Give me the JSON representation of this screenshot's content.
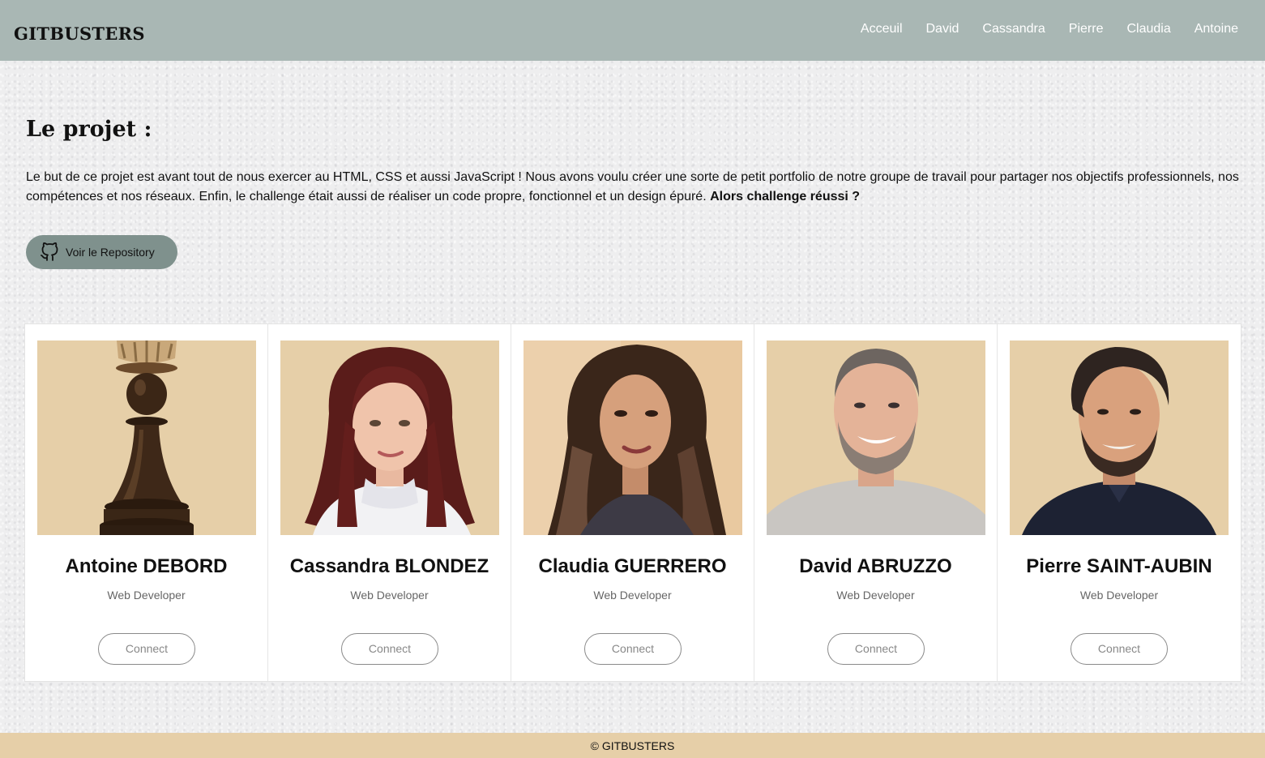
{
  "header": {
    "logo": "GITBUSTERS",
    "nav": [
      "Acceuil",
      "David",
      "Cassandra",
      "Pierre",
      "Claudia",
      "Antoine"
    ]
  },
  "project": {
    "title": "Le projet :",
    "description": "Le but de ce projet est avant tout de nous exercer au HTML, CSS et aussi JavaScript ! Nous avons voulu créer une sorte de petit portfolio de notre groupe de travail pour partager nos objectifs professionnels, nos compétences et nos réseaux. Enfin, le challenge était aussi de réaliser un code propre, fonctionnel et un design épuré.",
    "highlight": "Alors challenge réussi ?",
    "repo_button": "Voir le Repository",
    "repo_icon": "github-icon"
  },
  "team": [
    {
      "name": "Antoine DEBORD",
      "role": "Web Developer",
      "connect": "Connect",
      "photo": "chess-pawn-photo"
    },
    {
      "name": "Cassandra BLONDEZ",
      "role": "Web Developer",
      "connect": "Connect",
      "photo": "portrait-photo"
    },
    {
      "name": "Claudia GUERRERO",
      "role": "Web Developer",
      "connect": "Connect",
      "photo": "portrait-photo"
    },
    {
      "name": "David ABRUZZO",
      "role": "Web Developer",
      "connect": "Connect",
      "photo": "portrait-photo"
    },
    {
      "name": "Pierre SAINT-AUBIN",
      "role": "Web Developer",
      "connect": "Connect",
      "photo": "portrait-photo"
    }
  ],
  "footer": {
    "text": "© GITBUSTERS"
  },
  "colors": {
    "header_bg": "#a9b7b4",
    "accent_button": "#7f918d",
    "photo_bg": "#e6cfa8",
    "footer_bg": "#e6cfa8"
  }
}
